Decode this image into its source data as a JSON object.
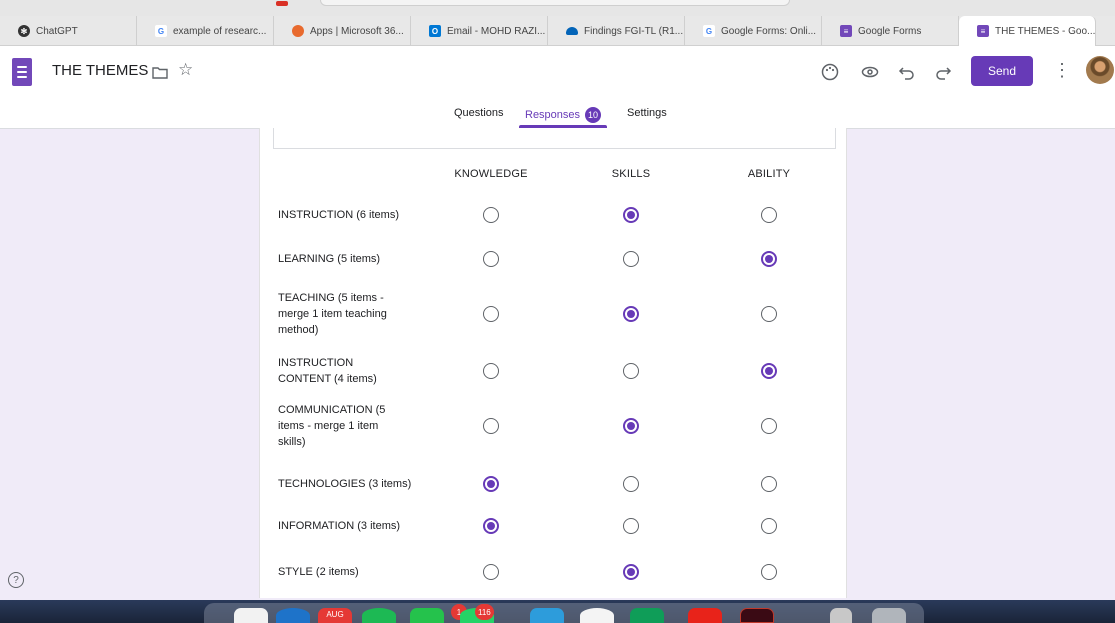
{
  "browser": {
    "tabs": [
      {
        "label": "ChatGPT",
        "icon": "chatgpt-icon",
        "color": "#333333"
      },
      {
        "label": "example of researc...",
        "icon": "google-icon",
        "color": "#4285f4"
      },
      {
        "label": "Apps | Microsoft 36...",
        "icon": "microsoft-icon",
        "color": "#e86a2e"
      },
      {
        "label": "Email - MOHD RAZI...",
        "icon": "outlook-icon",
        "color": "#0078d4"
      },
      {
        "label": "Findings FGI-TL (R1...",
        "icon": "onedrive-icon",
        "color": "#0364b8"
      },
      {
        "label": "Google Forms: Onli...",
        "icon": "google-icon",
        "color": "#4285f4"
      },
      {
        "label": "Google Forms",
        "icon": "forms-icon",
        "color": "#7248b9"
      },
      {
        "label": "THE THEMES - Goo...",
        "icon": "forms-icon",
        "color": "#7248b9"
      }
    ]
  },
  "header": {
    "title": "THE THEMES",
    "send_label": "Send",
    "accent": "#673ab7"
  },
  "nav": {
    "questions": "Questions",
    "responses": "Responses",
    "responses_count": "10",
    "settings": "Settings"
  },
  "grid": {
    "columns": [
      "KNOWLEDGE",
      "SKILLS",
      "ABILITY"
    ],
    "rows": [
      {
        "label": "INSTRUCTION (6 items)",
        "selected": 1
      },
      {
        "label": "LEARNING (5 items)",
        "selected": 2
      },
      {
        "label": "TEACHING (5 items - merge 1 item teaching method)",
        "selected": 1
      },
      {
        "label": "INSTRUCTION CONTENT (4 items)",
        "selected": 2
      },
      {
        "label": "COMMUNICATION (5 items - merge 1 item skills)",
        "selected": 1
      },
      {
        "label": "TECHNOLOGIES (3 items)",
        "selected": 0
      },
      {
        "label": "INFORMATION (3 items)",
        "selected": 0
      },
      {
        "label": "STYLE (2 items)",
        "selected": 1
      }
    ]
  },
  "dock": {
    "calendar_month": "AUG",
    "badges": [
      "1",
      "116"
    ]
  }
}
